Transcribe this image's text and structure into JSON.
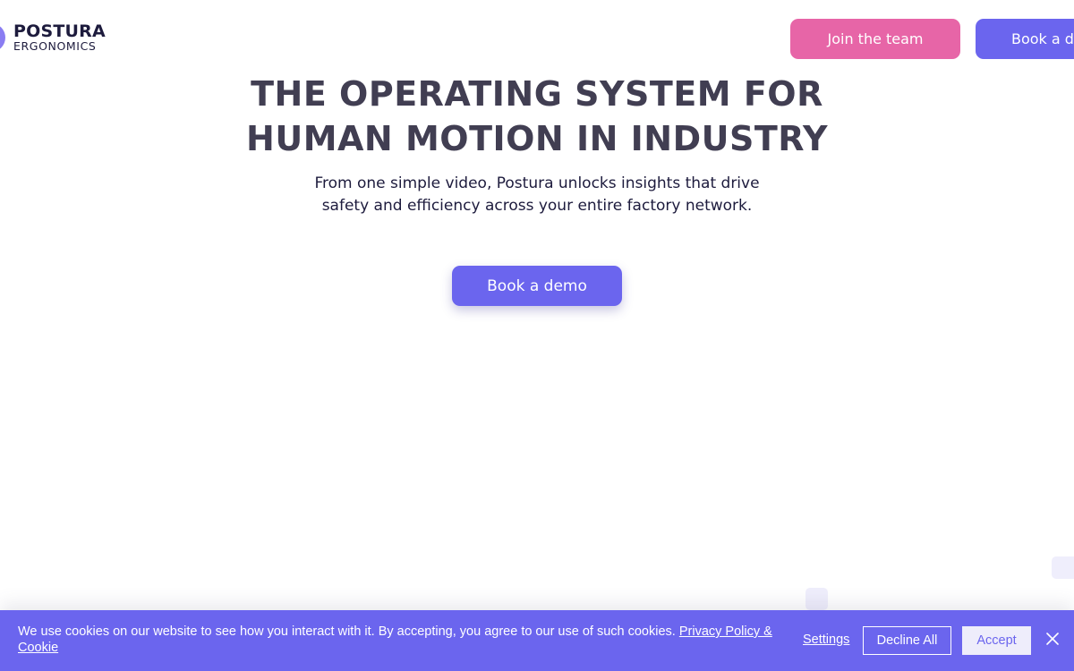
{
  "brand": {
    "name": "POSTURA",
    "tagline": "ERGONOMICS",
    "mark_color": "#8a7df2"
  },
  "header": {
    "join_label": "Join the team",
    "book_label": "Book a demo"
  },
  "hero": {
    "title_line1": "THE OPERATING SYSTEM FOR",
    "title_line2": "HUMAN MOTION IN INDUSTRY",
    "subtitle": "From one simple video, Postura unlocks insights that drive safety and efficiency across your entire factory network.",
    "cta_label": "Book a demo"
  },
  "cookie": {
    "text": "We use cookies on our website to see how you interact with it. By accepting, you agree to our use of such cookies.",
    "link_label": "Privacy Policy & Cookie",
    "settings_label": "Settings",
    "decline_label": "Decline All",
    "accept_label": "Accept",
    "close_icon": "close-icon"
  },
  "colors": {
    "primary": "#6b65ee",
    "pink": "#e765a7",
    "heading": "#413e52",
    "text": "#1d1b3d",
    "background": "#ffffff"
  }
}
